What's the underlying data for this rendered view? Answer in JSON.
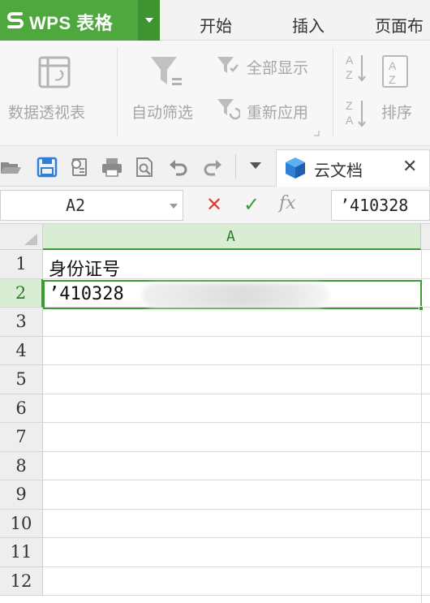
{
  "app": {
    "name": "WPS 表格",
    "brand_color": "#4fa83d"
  },
  "menu": {
    "tabs": [
      "开始",
      "插入",
      "页面布"
    ]
  },
  "ribbon": {
    "pivot_label": "数据透视表",
    "autofilter_label": "自动筛选",
    "show_all_label": "全部显示",
    "reapply_label": "重新应用",
    "sort_label": "排序"
  },
  "quick_access": {
    "icons": [
      "open-icon",
      "save-icon",
      "print-preview-icon",
      "print-icon",
      "preview-icon",
      "undo-icon",
      "redo-icon",
      "dropdown-icon"
    ]
  },
  "doc_tab": {
    "label": "云文档",
    "close": "✕"
  },
  "formula_bar": {
    "name_box": "A2",
    "cancel": "✕",
    "enter": "✓",
    "fx": "fx",
    "value": "’410328"
  },
  "sheet": {
    "column_header": "A",
    "row_numbers": [
      "1",
      "2",
      "3",
      "4",
      "5",
      "6",
      "7",
      "8",
      "9",
      "10",
      "11",
      "12"
    ],
    "active_row": "2",
    "cells": {
      "A1": "身份证号",
      "A2": "’410328"
    },
    "accent_color": "#3c9a35"
  }
}
